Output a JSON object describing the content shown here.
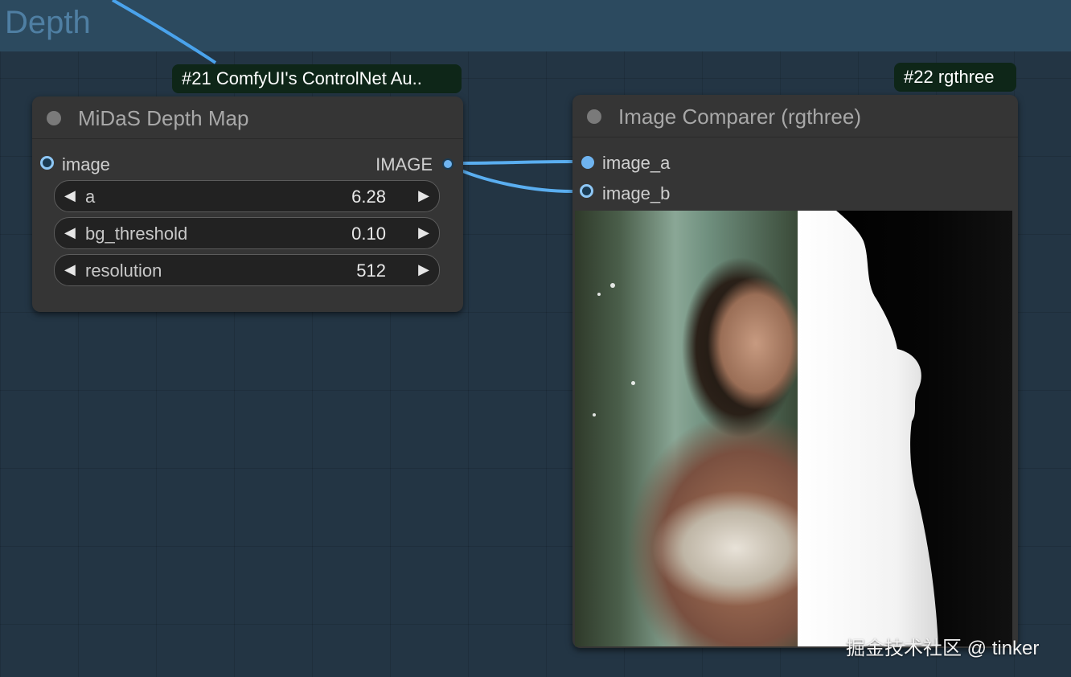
{
  "group": {
    "title": "Depth"
  },
  "node21": {
    "badge": "#21 ComfyUI's ControlNet Au..",
    "title": "MiDaS Depth Map",
    "input_label": "image",
    "output_label": "IMAGE",
    "widgets": [
      {
        "label": "a",
        "value": "6.28"
      },
      {
        "label": "bg_threshold",
        "value": "0.10"
      },
      {
        "label": "resolution",
        "value": "512"
      }
    ]
  },
  "node22": {
    "badge": "#22 rgthree",
    "title": "Image Comparer (rgthree)",
    "input_a": "image_a",
    "input_b": "image_b"
  },
  "icons": {
    "decrement": "◀",
    "increment": "▶"
  },
  "colors": {
    "canvas": "#233544",
    "group_header": "#2c4a5f",
    "node_body": "#353535",
    "badge_bg": "#0e2618",
    "wire": "#5aaef0"
  },
  "watermark": "掘金技术社区 @ tinker"
}
